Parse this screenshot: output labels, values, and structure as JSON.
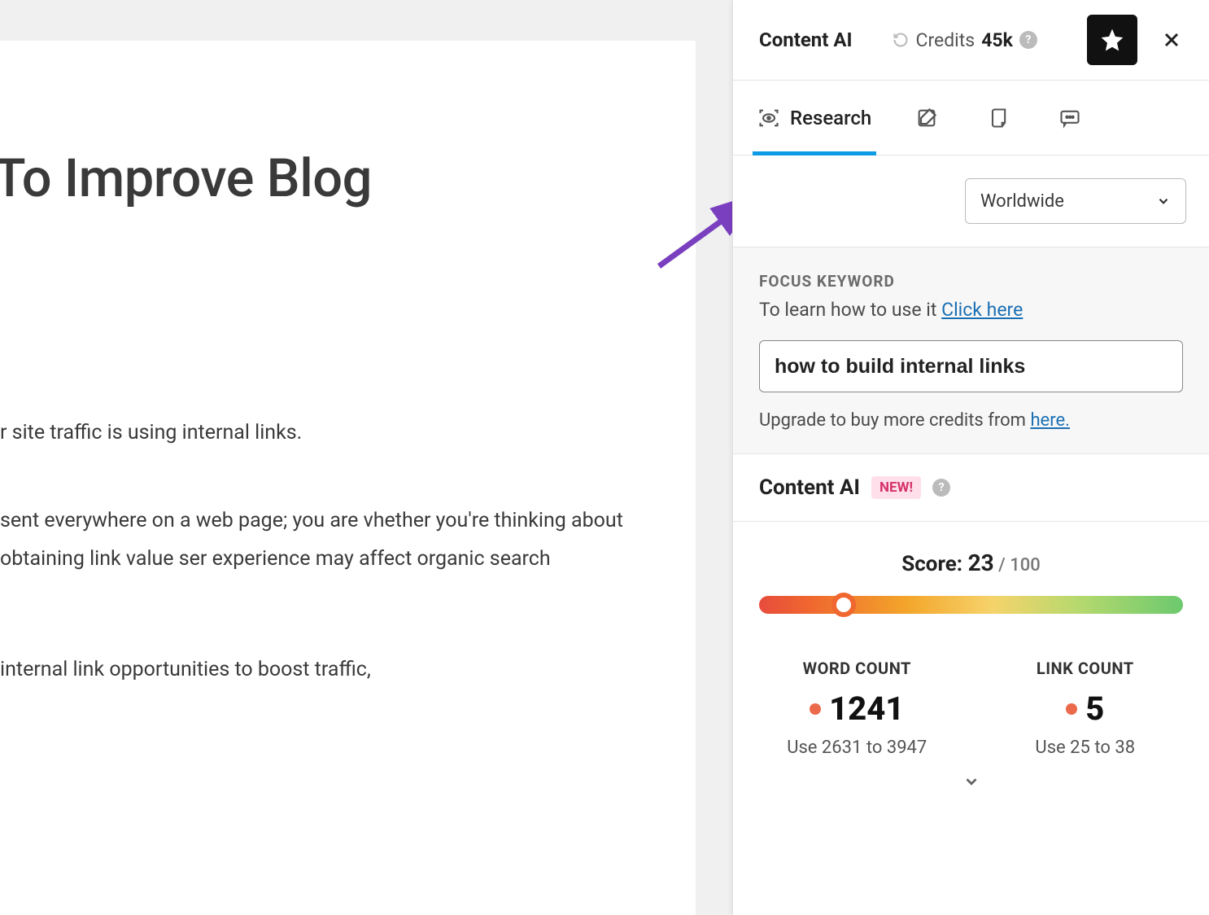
{
  "editor": {
    "title": "To Improve Blog",
    "para1": "r site traffic is using internal links.",
    "para2": "sent everywhere on a web page; you are vhether you're thinking about obtaining link value ser experience may affect organic search",
    "para3": "internal link opportunities to boost traffic,"
  },
  "sidebar": {
    "title": "Content AI",
    "credits_label": "Credits",
    "credits_value": "45k",
    "tabs": {
      "research": "Research"
    },
    "region": "Worldwide",
    "focus": {
      "heading": "FOCUS KEYWORD",
      "subtext": "To learn how to use it ",
      "sublink": "Click here",
      "value": "how to build internal links",
      "upgrade_text": "Upgrade to buy more credits from ",
      "upgrade_link": "here."
    },
    "score_section": {
      "title": "Content AI",
      "badge": "NEW!",
      "score_label": "Score: ",
      "score_value": "23",
      "score_max": " / 100",
      "metrics": [
        {
          "label": "WORD COUNT",
          "value": "1241",
          "hint": "Use 2631 to 3947"
        },
        {
          "label": "LINK COUNT",
          "value": "5",
          "hint": "Use 25 to 38"
        }
      ]
    }
  }
}
